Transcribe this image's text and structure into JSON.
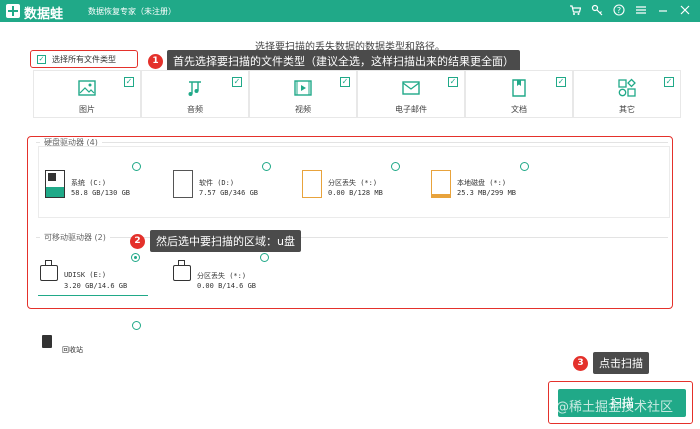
{
  "app": {
    "brand": "数据蛙",
    "subtitle": "数据恢复专家（未注册）",
    "icons": [
      "cart-icon",
      "key-icon",
      "help-icon",
      "menu-icon",
      "minimize-icon",
      "close-icon"
    ]
  },
  "instruction": "选择要扫描的丢失数据的数据类型和路径。",
  "select_all": {
    "label": "选择所有文件类型",
    "checked": true
  },
  "callouts": [
    {
      "num": "1",
      "text": "首先选择要扫描的文件类型（建议全选，这样扫描出来的结果更全面）"
    },
    {
      "num": "2",
      "text": "然后选中要扫描的区域：u盘"
    },
    {
      "num": "3",
      "text": "点击扫描"
    }
  ],
  "file_types": [
    {
      "label": "图片",
      "icon": "picture-icon",
      "checked": true
    },
    {
      "label": "音频",
      "icon": "music-icon",
      "checked": true
    },
    {
      "label": "视频",
      "icon": "video-icon",
      "checked": true
    },
    {
      "label": "电子邮件",
      "icon": "mail-icon",
      "checked": true
    },
    {
      "label": "文档",
      "icon": "document-icon",
      "checked": true
    },
    {
      "label": "其它",
      "icon": "apps-icon",
      "checked": true
    }
  ],
  "hard_drives": {
    "title": "硬盘驱动器 (4)",
    "items": [
      {
        "name": "系统 (C:)",
        "size": "58.8 GB/130 GB",
        "icon": "system-drive-icon"
      },
      {
        "name": "软件 (D:)",
        "size": "7.57 GB/346 GB",
        "icon": "drive-icon"
      },
      {
        "name": "分区丢失 (*:)",
        "size": "0.00  B/128 MB",
        "icon": "lost-partition-icon"
      },
      {
        "name": "本地磁盘 (*:)",
        "size": "25.3 MB/299 MB",
        "icon": "local-disk-icon"
      }
    ]
  },
  "removable": {
    "title": "可移动驱动器 (2)",
    "items": [
      {
        "name": "UDISK (E:)",
        "size": "3.20 GB/14.6 GB",
        "icon": "usb-drive-icon",
        "selected": true
      },
      {
        "name": "分区丢失 (*:)",
        "size": "0.00  B/14.6 GB",
        "icon": "usb-drive-icon",
        "selected": false
      }
    ]
  },
  "recycle_bin": {
    "label": "回收站",
    "icon": "recycle-bin-icon"
  },
  "scan_button": "扫描",
  "watermark": "@稀土掘金技术社区",
  "colors": {
    "brand": "#20a988",
    "highlight": "#e4312b",
    "callout_bg": "#4b4b4b"
  }
}
